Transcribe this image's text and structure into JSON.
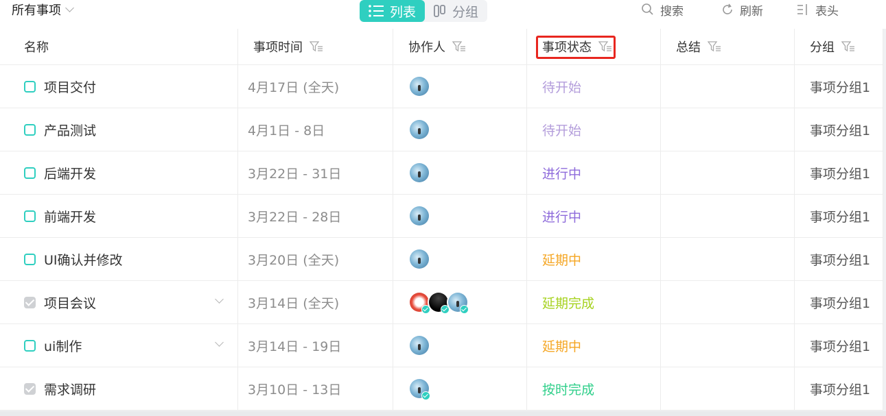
{
  "toolbar": {
    "view_name": "所有事项",
    "tabs": [
      {
        "label": "列表",
        "active": true
      },
      {
        "label": "分组",
        "active": false
      }
    ],
    "search_label": "搜索",
    "refresh_label": "刷新",
    "columns_label": "表头"
  },
  "table": {
    "headers": {
      "name": "名称",
      "time": "事项时间",
      "collaborators": "协作人",
      "status": "事项状态",
      "summary": "总结",
      "group": "分组"
    },
    "rows": [
      {
        "name": "项目交付",
        "time": "4月17日 (全天)",
        "status": "待开始",
        "status_color": "#b39ddb",
        "group": "事项分组1",
        "done": false,
        "expandable": false,
        "avatars": [
          "blue"
        ]
      },
      {
        "name": "产品测试",
        "time": "4月1日 - 8日",
        "status": "待开始",
        "status_color": "#b39ddb",
        "group": "事项分组1",
        "done": false,
        "expandable": false,
        "avatars": [
          "blue"
        ]
      },
      {
        "name": "后端开发",
        "time": "3月22日 - 31日",
        "status": "进行中",
        "status_color": "#8e6bdb",
        "group": "事项分组1",
        "done": false,
        "expandable": false,
        "avatars": [
          "blue"
        ]
      },
      {
        "name": "前端开发",
        "time": "3月22日 - 28日",
        "status": "进行中",
        "status_color": "#8e6bdb",
        "group": "事项分组1",
        "done": false,
        "expandable": false,
        "avatars": [
          "blue"
        ]
      },
      {
        "name": "UI确认并修改",
        "time": "3月20日 (全天)",
        "status": "延期中",
        "status_color": "#f5a623",
        "group": "事项分组1",
        "done": false,
        "expandable": false,
        "avatars": [
          "blue"
        ]
      },
      {
        "name": "项目会议",
        "time": "3月14日 (全天)",
        "status": "延期完成",
        "status_color": "#a6d21f",
        "group": "事项分组1",
        "done": true,
        "expandable": true,
        "avatars": [
          "red",
          "dark",
          "blue"
        ]
      },
      {
        "name": "ui制作",
        "time": "3月14日 - 19日",
        "status": "延期中",
        "status_color": "#f5a623",
        "group": "事项分组1",
        "done": false,
        "expandable": true,
        "avatars": [
          "blue"
        ]
      },
      {
        "name": "需求调研",
        "time": "3月10日 - 13日",
        "status": "按时完成",
        "status_color": "#2fcf8a",
        "group": "事项分组1",
        "done": true,
        "expandable": false,
        "avatars": [
          "blue-check"
        ]
      }
    ]
  },
  "colors": {
    "accent": "#2fcfc0",
    "highlight_box": "#e8261f"
  }
}
